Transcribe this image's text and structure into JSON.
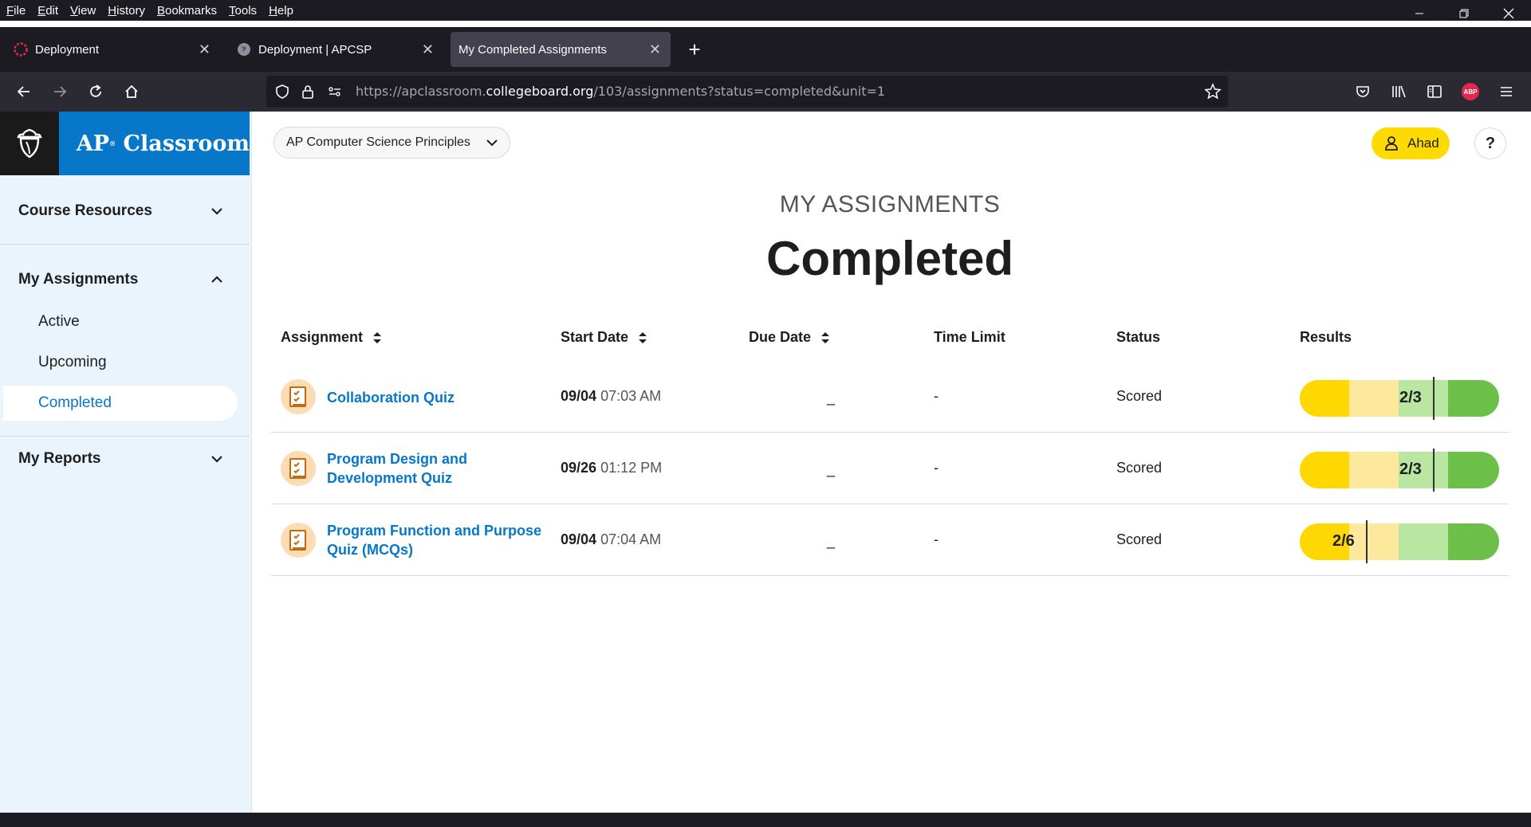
{
  "browser": {
    "menu": [
      "File",
      "Edit",
      "View",
      "History",
      "Bookmarks",
      "Tools",
      "Help"
    ],
    "tabs": [
      {
        "label": "Deployment",
        "icon": "red-ring-icon"
      },
      {
        "label": "Deployment | APCSP",
        "icon": "globe-icon"
      },
      {
        "label": "My Completed Assignments",
        "icon": "none",
        "active": true
      }
    ],
    "url_prefix": "https://apclassroom.",
    "url_domain": "collegeboard.org",
    "url_suffix": "/103/assignments?status=completed&unit=1",
    "toolbar_icons": [
      "pocket-icon",
      "library-icon",
      "sidebar-icon",
      "abp-icon",
      "hamburger-menu-icon"
    ],
    "abp_label": "ABP"
  },
  "brand": {
    "name_prefix": "AP",
    "name_suffix": "Classroom",
    "registered": "®",
    "color": "#0677c9"
  },
  "sidebar": {
    "course_resources": "Course Resources",
    "my_assignments": "My Assignments",
    "sub_items": [
      "Active",
      "Upcoming",
      "Completed"
    ],
    "my_reports": "My Reports"
  },
  "header": {
    "course": "AP Computer Science Principles",
    "user": "Ahad",
    "help": "?"
  },
  "main": {
    "eyebrow": "MY ASSIGNMENTS",
    "title": "Completed",
    "columns": [
      "Assignment",
      "Start Date",
      "Due Date",
      "Time Limit",
      "Status",
      "Results"
    ]
  },
  "rows": [
    {
      "name_line1": "Collaboration Quiz",
      "name_line2": "",
      "start_date": "09/04",
      "start_time": "07:03 AM",
      "due": "_",
      "time_limit": "-",
      "status": "Scored",
      "score": "2/3",
      "score_fraction": 0.667
    },
    {
      "name_line1": "Program Design and",
      "name_line2": "Development Quiz",
      "start_date": "09/26",
      "start_time": "01:12 PM",
      "due": "_",
      "time_limit": "-",
      "status": "Scored",
      "score": "2/3",
      "score_fraction": 0.667
    },
    {
      "name_line1": "Program Function and Purpose",
      "name_line2": "Quiz (MCQs)",
      "start_date": "09/04",
      "start_time": "07:04 AM",
      "due": "_",
      "time_limit": "-",
      "status": "Scored",
      "score": "2/6",
      "score_fraction": 0.333
    }
  ],
  "colors": {
    "score_segments": [
      "#fed800",
      "#fde99e",
      "#b9e6a0",
      "#6cc04a"
    ],
    "user_button": "#fedb00",
    "link": "#0677c9"
  }
}
